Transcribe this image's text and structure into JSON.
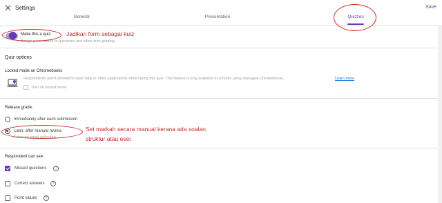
{
  "header": {
    "close_glyph": "✕",
    "title": "Settings",
    "save_label": "Save",
    "tabs": [
      {
        "label": "General",
        "active": false
      },
      {
        "label": "Presentation",
        "active": false
      },
      {
        "label": "Quizzes",
        "active": true
      }
    ]
  },
  "quiz_toggle": {
    "label": "Make this a quiz",
    "description": "Assign point values to questions and allow auto-grading.",
    "on": true
  },
  "quiz_options": {
    "heading": "Quiz options",
    "locked_mode": {
      "heading": "Locked mode on Chromebooks",
      "description": "Respondents aren't allowed to open tabs or other applications while taking this quiz. This feature is only available to schools using managed Chromebooks.",
      "learn_more": "Learn more",
      "checkbox_label": "Turn on locked mode",
      "checked": false
    },
    "release_grade": {
      "heading": "Release grade:",
      "options": [
        {
          "label": "Immediately after each submission",
          "selected": false
        },
        {
          "label": "Later, after manual review",
          "sublabel": "Turns on email collection",
          "selected": true
        }
      ]
    },
    "respondent_can_see": {
      "heading": "Respondent can see:",
      "items": [
        {
          "label": "Missed questions",
          "checked": true
        },
        {
          "label": "Correct answers",
          "checked": false
        },
        {
          "label": "Point values",
          "checked": false
        }
      ]
    }
  },
  "annotations": {
    "quiz": "Jadikan form sebagai kuiz",
    "grade_line1": "Set markah secara manual kerana ada soalan",
    "grade_line2": "struktur atau esei"
  },
  "colors": {
    "accent": "#673ab7",
    "annotation": "#c62828"
  }
}
